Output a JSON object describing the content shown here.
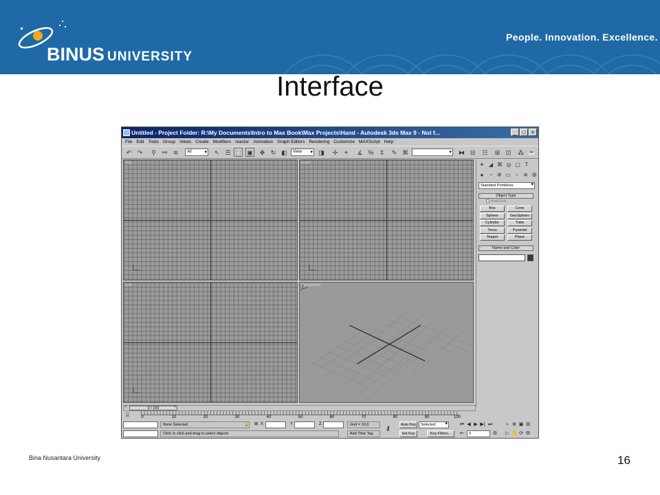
{
  "header": {
    "logo_main": "BINUS",
    "logo_sub": "UNIVERSITY",
    "tagline": "People. Innovation. Excellence.",
    "bg_color": "#1f6aa6"
  },
  "slide": {
    "title": "Interface",
    "footer": "Bina Nusantara University",
    "page_number": "16"
  },
  "app": {
    "window_title": "Untitled     - Project Folder: R:\\My Documents\\Intro to Max Book\\Max Projects\\Hand     - Autodesk 3ds Max 9  - Not f...",
    "menu": [
      "File",
      "Edit",
      "Tools",
      "Group",
      "Views",
      "Create",
      "Modifiers",
      "reactor",
      "Animation",
      "Graph Editors",
      "Rendering",
      "Customize",
      "MAXScript",
      "Help"
    ],
    "toolbar": {
      "selection_filter": "All",
      "reference_coord": "View"
    },
    "viewports": [
      {
        "label": "Top"
      },
      {
        "label": "Front"
      },
      {
        "label": "Left"
      },
      {
        "label": "Perspective"
      }
    ],
    "command_panel": {
      "category": "Standard Primitives",
      "object_type_title": "Object Type",
      "autogrid": "AutoGrid",
      "buttons": [
        "Box",
        "Cone",
        "Sphere",
        "GeoSphere",
        "Cylinder",
        "Tube",
        "Torus",
        "Pyramid",
        "Teapot",
        "Plane"
      ],
      "name_color_title": "Name and Color"
    },
    "time_slider": {
      "value": "0 / 100"
    },
    "track_ticks": [
      "0",
      "10",
      "20",
      "30",
      "40",
      "50",
      "60",
      "70",
      "80",
      "90",
      "100"
    ],
    "status": {
      "selection": "None Selected",
      "prompt": "Click or click-and-drag to select objects",
      "x_label": "X",
      "y_label": "Y",
      "z_label": "Z",
      "grid": "Grid = 10.0",
      "add_time_tag": "Add Time Tag",
      "auto_key": "Auto Key",
      "key_mode": "Selected",
      "set_key": "Set Key",
      "key_filters": "Key Filters...",
      "frame": "0"
    }
  }
}
